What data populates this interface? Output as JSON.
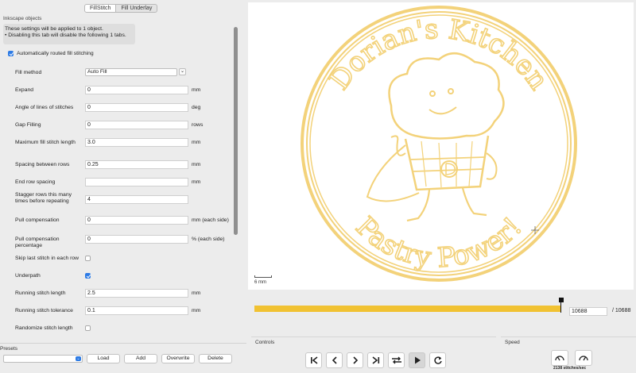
{
  "tabs": [
    {
      "label": "FillStitch",
      "active": true
    },
    {
      "label": "Fill Underlay",
      "active": false
    }
  ],
  "group_label": "Inkscape objects",
  "info": {
    "line1": "These settings will be applied to 1 object.",
    "line2": "• Disabling this tab will disable the following 1 tabs."
  },
  "auto_fill": {
    "label": "Automatically routed fill stitching",
    "checked": true
  },
  "fill_method": {
    "label": "Fill method",
    "value": "Auto Fill"
  },
  "params": [
    {
      "label": "Expand",
      "value": "0",
      "unit": "mm"
    },
    {
      "label": "Angle of lines of stitches",
      "value": "0",
      "unit": "deg"
    },
    {
      "label": "Gap Filling",
      "value": "0",
      "unit": "rows"
    },
    {
      "label": "Maximum fill stitch length",
      "value": "3.0",
      "unit": "mm"
    },
    {
      "label": "Spacing between rows",
      "value": "0.25",
      "unit": "mm"
    },
    {
      "label": "End row spacing",
      "value": "",
      "unit": "mm"
    },
    {
      "label": "Stagger rows this many times before repeating",
      "value": "4",
      "unit": ""
    },
    {
      "label": "Pull compensation",
      "value": "0",
      "unit": "mm (each side)"
    },
    {
      "label": "Pull compensation percentage",
      "value": "0",
      "unit": "% (each side)"
    },
    {
      "label": "Skip last stitch in each row",
      "checkbox": true,
      "checked": false
    },
    {
      "label": "Underpath",
      "checkbox": true,
      "checked": true
    },
    {
      "label": "Running stitch length",
      "value": "2.5",
      "unit": "mm"
    },
    {
      "label": "Running stitch tolerance",
      "value": "0.1",
      "unit": "mm"
    },
    {
      "label": "Randomize stitch length",
      "checkbox": true,
      "checked": false
    }
  ],
  "presets": {
    "label": "Presets",
    "buttons": [
      "Load",
      "Add",
      "Overwrite",
      "Delete"
    ]
  },
  "canvas": {
    "scale_label": "6 mm",
    "design_top_text": "Dorian's Kitchen",
    "design_bottom_text": "Pastry Power!",
    "stitch_color": "#f3d27a"
  },
  "progress": {
    "current": "10688",
    "total": "/ 10688",
    "fraction": 1.0,
    "color": "#f1c232"
  },
  "controls": {
    "label": "Controls"
  },
  "speed": {
    "label": "Speed",
    "value_text": "2138 stitches/sec"
  }
}
